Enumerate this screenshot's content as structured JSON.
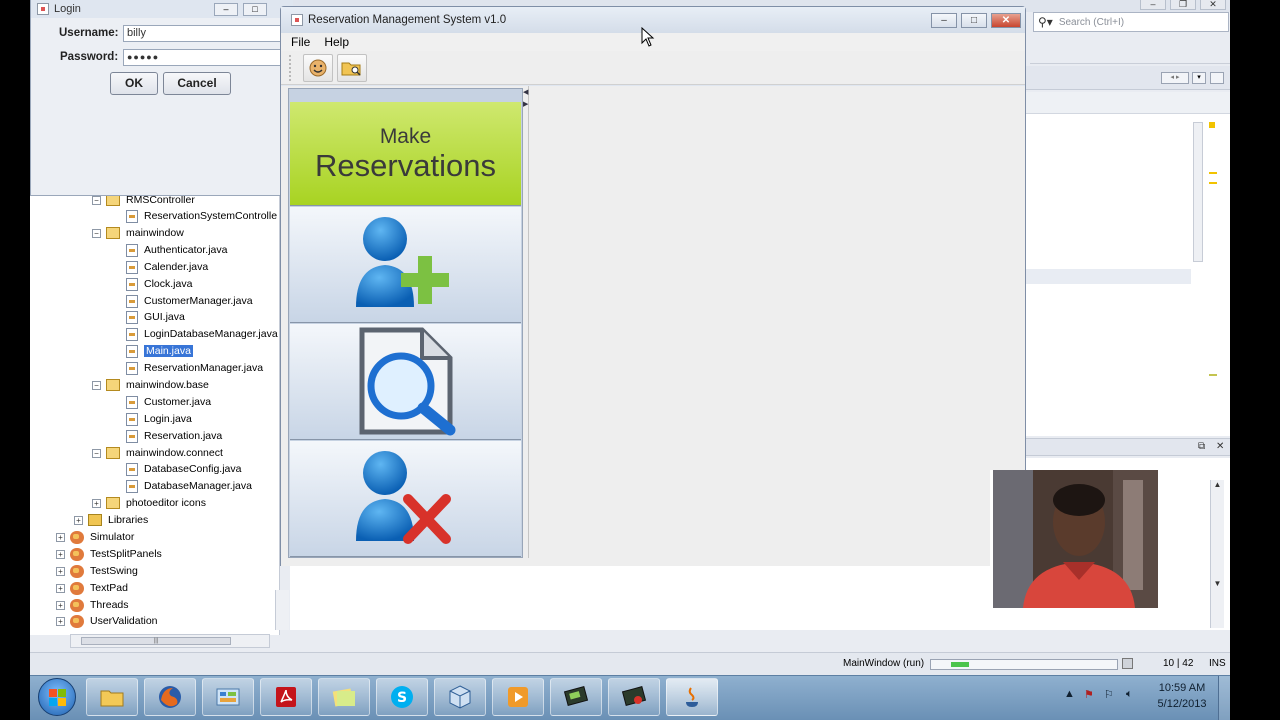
{
  "ide": {
    "search_placeholder": "Search (Ctrl+I)",
    "status_run": "MainWindow (run)",
    "status_pos": "10 | 42",
    "status_ins": "INS"
  },
  "tree": {
    "items": [
      {
        "label": "RMSController",
        "kind": "package"
      },
      {
        "label": "ReservationSystemControlle",
        "kind": "file"
      },
      {
        "label": "mainwindow",
        "kind": "package"
      },
      {
        "label": "Authenticator.java",
        "kind": "file"
      },
      {
        "label": "Calender.java",
        "kind": "file"
      },
      {
        "label": "Clock.java",
        "kind": "file"
      },
      {
        "label": "CustomerManager.java",
        "kind": "file"
      },
      {
        "label": "GUI.java",
        "kind": "file"
      },
      {
        "label": "LoginDatabaseManager.java",
        "kind": "file"
      },
      {
        "label": "Main.java",
        "kind": "file",
        "selected": true
      },
      {
        "label": "ReservationManager.java",
        "kind": "file"
      },
      {
        "label": "mainwindow.base",
        "kind": "package"
      },
      {
        "label": "Customer.java",
        "kind": "file"
      },
      {
        "label": "Login.java",
        "kind": "file"
      },
      {
        "label": "Reservation.java",
        "kind": "file"
      },
      {
        "label": "mainwindow.connect",
        "kind": "package"
      },
      {
        "label": "DatabaseConfig.java",
        "kind": "file"
      },
      {
        "label": "DatabaseManager.java",
        "kind": "file"
      },
      {
        "label": "photoeditor icons",
        "kind": "package"
      },
      {
        "label": "Libraries",
        "kind": "libraries"
      },
      {
        "label": "Simulator",
        "kind": "project"
      },
      {
        "label": "TestSplitPanels",
        "kind": "project"
      },
      {
        "label": "TestSwing",
        "kind": "project"
      },
      {
        "label": "TextPad",
        "kind": "project"
      },
      {
        "label": "Threads",
        "kind": "project"
      },
      {
        "label": "UserValidation",
        "kind": "project"
      }
    ]
  },
  "login": {
    "title": "Login",
    "username_label": "Username:",
    "username_value": "billy",
    "password_label": "Password:",
    "password_value": "●●●●●",
    "ok_label": "OK",
    "cancel_label": "Cancel"
  },
  "rms": {
    "title": "Reservation Management System v1.0",
    "menu": [
      "File",
      "Help"
    ],
    "make_line1": "Make",
    "make_line2": "Reservations"
  },
  "taskbar": {
    "time": "10:59 AM",
    "date": "5/12/2013"
  }
}
